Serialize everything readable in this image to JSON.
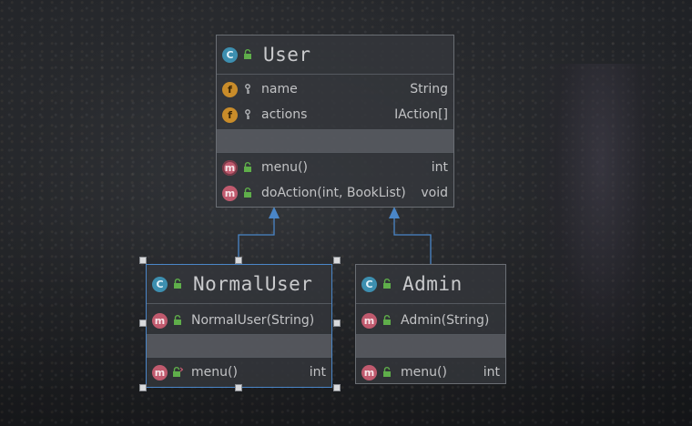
{
  "colors": {
    "class_badge": "#3d8fb0",
    "field_badge": "#c98c2a",
    "method_badge": "#c05a6e",
    "selection": "#4a86c8",
    "arrow": "#4a86c8"
  },
  "nodes": {
    "user": {
      "badge": "C",
      "title": "User",
      "fields": [
        {
          "icon": "field-icon",
          "badge": "f",
          "visibility": "key-icon",
          "name": "name",
          "type": "String"
        },
        {
          "icon": "field-icon",
          "badge": "f",
          "visibility": "key-icon",
          "name": "actions",
          "type": "IAction[]"
        }
      ],
      "methods": [
        {
          "icon": "abstract-method-icon",
          "badge": "m",
          "visibility": "lock-icon",
          "name": "menu()",
          "type": "int"
        },
        {
          "icon": "method-icon",
          "badge": "m",
          "visibility": "lock-icon",
          "name": "doAction(int, BookList)",
          "type": "void"
        }
      ]
    },
    "normal_user": {
      "badge": "C",
      "title": "NormalUser",
      "constructors": [
        {
          "badge": "m",
          "name": "NormalUser(String)"
        }
      ],
      "methods": [
        {
          "badge": "m",
          "name": "menu()",
          "type": "int"
        }
      ]
    },
    "admin": {
      "badge": "C",
      "title": "Admin",
      "constructors": [
        {
          "badge": "m",
          "name": "Admin(String)"
        }
      ],
      "methods": [
        {
          "badge": "m",
          "name": "menu()",
          "type": "int"
        }
      ]
    }
  },
  "edges": [
    {
      "from": "NormalUser",
      "to": "User",
      "kind": "extends"
    },
    {
      "from": "Admin",
      "to": "User",
      "kind": "extends"
    }
  ]
}
